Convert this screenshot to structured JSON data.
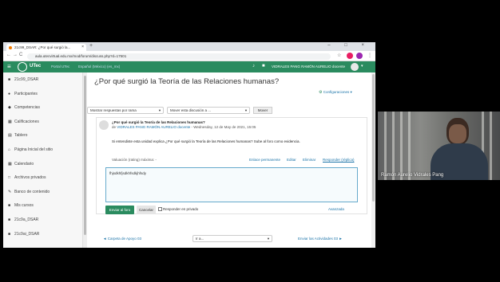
{
  "browser": {
    "tab_title": "21c99_DSAR: ¿Por qué surgió la...",
    "tab_close": "×",
    "new_tab": "+",
    "window_controls": "–  □  ×",
    "url": "aula.utecvirtual.edu.mx/mod/forum/discuss.php?d=17501"
  },
  "topnav": {
    "brand": "UTec",
    "links": [
      "Portal UTec",
      "Español (México) (es_mx)"
    ],
    "user": "VIDRALES PANG RAMÓN AURELIO docente"
  },
  "sidebar": {
    "items": [
      {
        "icon": "graduation-cap-icon",
        "glyph": "■",
        "label": "21c99_DSAR"
      },
      {
        "icon": "users-icon",
        "glyph": "●",
        "label": "Participantes"
      },
      {
        "icon": "badge-icon",
        "glyph": "◆",
        "label": "Competencias"
      },
      {
        "icon": "grades-icon",
        "glyph": "▦",
        "label": "Calificaciones"
      },
      {
        "icon": "tablero-icon",
        "glyph": "▤",
        "label": "Tablero"
      },
      {
        "icon": "home-icon",
        "glyph": "⌂",
        "label": "Página Inicial del sitio"
      },
      {
        "icon": "calendar-icon",
        "glyph": "▦",
        "label": "Calendario"
      },
      {
        "icon": "file-icon",
        "glyph": "□",
        "label": "Archivos privados"
      },
      {
        "icon": "pencil-icon",
        "glyph": "✎",
        "label": "Banco de contenido"
      },
      {
        "icon": "graduation-cap-icon",
        "glyph": "■",
        "label": "Mis cursos"
      },
      {
        "icon": "graduation-cap-icon",
        "glyph": "■",
        "label": "21c9a_DSAR"
      },
      {
        "icon": "graduation-cap-icon",
        "glyph": "■",
        "label": "21c9ai_DSAR"
      }
    ]
  },
  "main": {
    "title": "¿Por qué surgió la Teoría de las Relaciones humanas?",
    "config": "Configuraciones ▾",
    "display_mode": "Mostrar respuestas por rama",
    "move_to": "Mover esta discusión a ...",
    "move_button": "Mover",
    "post": {
      "subject": "¿Por qué surgió la Teoría de las Relaciones humanas?",
      "by": "de",
      "author": "VIDRALES PANG RAMÓN AURELIO docente",
      "date": "- Wednesday, 12 de May de 2021, 15:05",
      "body": "Si entendiste esta unidad explica ¿Por qué surgió la Teoría de las Relaciones humanas? Sube al foro como evidencia.",
      "rating": "Valuación (rating) máxima: -",
      "links": [
        "Enlace permanente",
        "Editar",
        "Eliminar",
        "Responder (réplica)"
      ]
    },
    "reply": {
      "text": "fhjsdkhfjsdkhfsdkjhfsdy",
      "send": "Enviar al foro",
      "cancel": "Cancelar",
      "private": "Responder en privado",
      "advanced": "Avanzada"
    },
    "footer": {
      "prev": "◄ Carpeta de Apoyo 03",
      "jump": "Ir a...",
      "next": "Enviar las Actividades 03 ►"
    }
  },
  "webcam": {
    "name": "Ramón Aurelio Vidrales Pang"
  },
  "colors": {
    "brand_green": "#2a8b5f",
    "link_blue": "#1a73a8"
  }
}
